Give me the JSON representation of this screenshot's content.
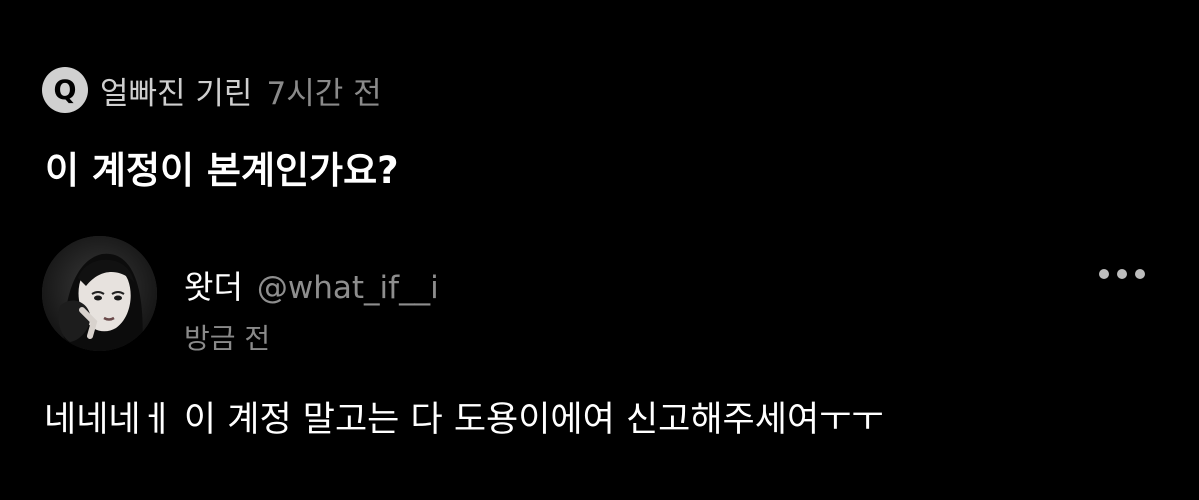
{
  "question": {
    "badge": "Q",
    "author": "얼빠진 기린",
    "time": "7시간 전",
    "text": "이 계정이 본계인가요?"
  },
  "reply": {
    "avatar_icon": "profile-avatar-image",
    "display_name": "왓더",
    "handle": "@what_if__i",
    "time": "방금 전",
    "more_icon": "more-horizontal-icon",
    "text": "네네네ㅔ 이 계정 말고는 다 도용이에여 신고해주세여ㅜㅜ"
  },
  "colors": {
    "background": "#000000",
    "primary_text": "#ffffff",
    "secondary_text": "#8a8a8a",
    "badge_bg": "#d0d0d0"
  }
}
